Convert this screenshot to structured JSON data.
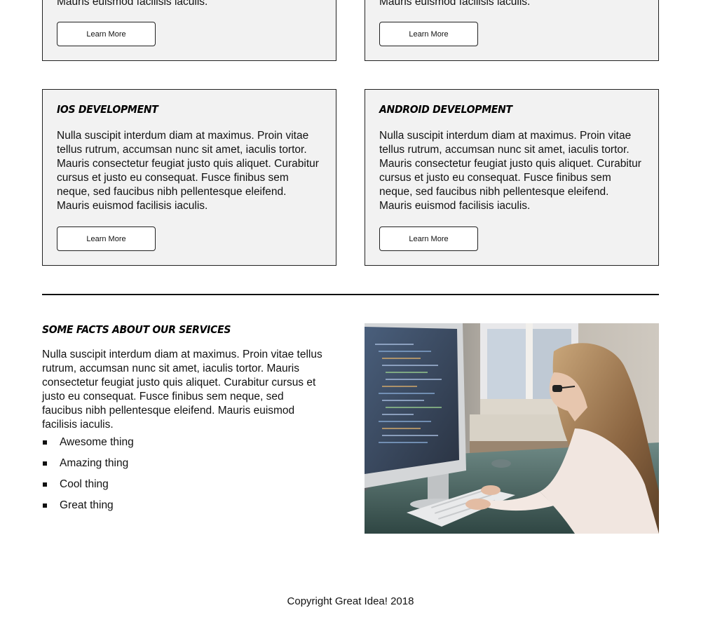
{
  "cards_top": [
    {
      "body": "Nulla suscipit interdum diam at maximus. Proin vitae tellus rutrum, accumsan nunc sit amet, iaculis tortor. Mauris consectetur feugiat justo quis aliquet. Curabitur cursus et justo eu consequat. Fusce finibus sem neque, sed faucibus nibh pellentesque eleifend. Mauris euismod facilisis iaculis.",
      "button_label": "Learn More"
    },
    {
      "body": "Nulla suscipit interdum diam at maximus. Proin vitae tellus rutrum, accumsan nunc sit amet, iaculis tortor. Mauris consectetur feugiat justo quis aliquet. Curabitur cursus et justo eu consequat. Fusce finibus sem neque, sed faucibus nibh pellentesque eleifend. Mauris euismod facilisis iaculis.",
      "button_label": "Learn More"
    }
  ],
  "cards": [
    {
      "title": "iOS Development",
      "body": "Nulla suscipit interdum diam at maximus. Proin vitae tellus rutrum, accumsan nunc sit amet, iaculis tortor. Mauris consectetur feugiat justo quis aliquet. Curabitur cursus et justo eu consequat. Fusce finibus sem neque, sed faucibus nibh pellentesque eleifend. Mauris euismod facilisis iaculis.",
      "button_label": "Learn More"
    },
    {
      "title": "Android Development",
      "body": "Nulla suscipit interdum diam at maximus. Proin vitae tellus rutrum, accumsan nunc sit amet, iaculis tortor. Mauris consectetur feugiat justo quis aliquet. Curabitur cursus et justo eu consequat. Fusce finibus sem neque, sed faucibus nibh pellentesque eleifend. Mauris euismod facilisis iaculis.",
      "button_label": "Learn More"
    }
  ],
  "facts": {
    "title": "Some facts about our services",
    "body": "Nulla suscipit interdum diam at maximus. Proin vitae tellus rutrum, accumsan nunc sit amet, iaculis tortor. Mauris consectetur feugiat justo quis aliquet. Curabitur cursus et justo eu consequat. Fusce finibus sem neque, sed faucibus nibh pellentesque eleifend. Mauris euismod facilisis iaculis.",
    "items": [
      "Awesome thing",
      "Amazing thing",
      "Cool thing",
      "Great thing"
    ]
  },
  "footer": {
    "copyright": "Copyright Great Idea! 2018"
  }
}
